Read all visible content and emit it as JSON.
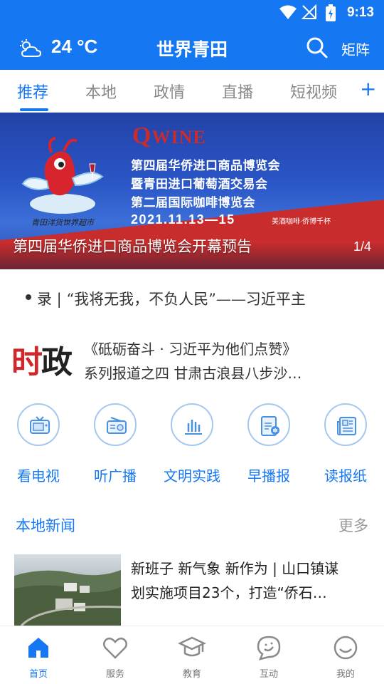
{
  "status_bar": {
    "time": "9:13"
  },
  "header": {
    "weather_icon": "partly-cloudy-icon",
    "temperature": "24 °C",
    "title": "世界青田",
    "search_icon": "search-icon",
    "matrix_label": "矩阵"
  },
  "tabs": [
    {
      "label": "推荐",
      "active": true
    },
    {
      "label": "本地",
      "active": false
    },
    {
      "label": "政情",
      "active": false
    },
    {
      "label": "直播",
      "active": false
    },
    {
      "label": "短视频",
      "active": false
    }
  ],
  "tab_add": "+",
  "banner": {
    "logo_text": "WINE",
    "logo_letter": "Q",
    "mascot_caption": "青田洋货世界超市",
    "lines": [
      "第四届华侨进口商品博览会",
      "暨青田进口葡萄酒交易会",
      "第二届国际咖啡博览会"
    ],
    "date": "2021.11.13—15",
    "tag": "美酒咖啡·侨博千杯",
    "caption": "第四届华侨进口商品博览会开幕预告",
    "index": "1/4"
  },
  "marquee": {
    "text": "录 | “我将无我，不负人民”——习近平主"
  },
  "politics": {
    "badge_red": "时",
    "badge_black": "政",
    "line1": "《砥砺奋斗 · 习近平为他们点赞》",
    "line2": "系列报道之四 甘肃古浪县八步沙…"
  },
  "quick_links": [
    {
      "label": "看电视",
      "icon": "tv-icon"
    },
    {
      "label": "听广播",
      "icon": "radio-icon"
    },
    {
      "label": "文明实践",
      "icon": "bar-chart-icon"
    },
    {
      "label": "早播报",
      "icon": "news-audio-icon"
    },
    {
      "label": "读报纸",
      "icon": "newspaper-icon"
    }
  ],
  "local_news": {
    "title": "本地新闻",
    "more": "更多",
    "items": [
      {
        "line1": "新班子 新气象 新作为 | 山口镇谋",
        "line2": "划实施项目23个，打造“侨石…"
      }
    ]
  },
  "bottom_nav": [
    {
      "label": "首页",
      "icon": "home-icon",
      "active": true
    },
    {
      "label": "服务",
      "icon": "heart-icon",
      "active": false
    },
    {
      "label": "教育",
      "icon": "graduation-cap-icon",
      "active": false
    },
    {
      "label": "互动",
      "icon": "chat-bubble-icon",
      "active": false
    },
    {
      "label": "我的",
      "icon": "smiley-icon",
      "active": false
    }
  ],
  "colors": {
    "brand": "#1677f2",
    "accent_red": "#d0272b"
  }
}
